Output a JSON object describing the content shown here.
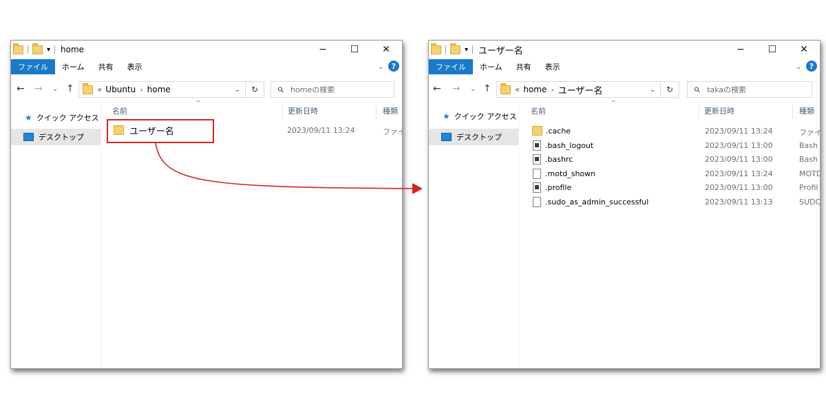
{
  "left": {
    "title": "home",
    "ribbon": {
      "file": "ファイル",
      "home": "ホーム",
      "share": "共有",
      "view": "表示"
    },
    "caption": {
      "minimize": "−",
      "maximize": "☐",
      "close": "✕"
    },
    "crumbs": {
      "more": "«",
      "c1": "Ubuntu",
      "sep": "›",
      "c2": "home"
    },
    "search_placeholder": "homeの検索",
    "sidebar": {
      "quick_access": "クイック アクセス",
      "desktop": "デスクトップ"
    },
    "columns": {
      "name": "名前",
      "date": "更新日時",
      "type": "種類"
    },
    "files": [
      {
        "name": "ユーザー名",
        "date": "2023/09/11 13:24",
        "type": "ファイル"
      }
    ]
  },
  "right": {
    "title": "ユーザー名",
    "ribbon": {
      "file": "ファイル",
      "home": "ホーム",
      "share": "共有",
      "view": "表示"
    },
    "caption": {
      "minimize": "−",
      "maximize": "☐",
      "close": "✕"
    },
    "crumbs": {
      "more": "«",
      "c1": "home",
      "sep": "›",
      "c2": "ユーザー名"
    },
    "search_placeholder": "takaの検索",
    "sidebar": {
      "quick_access": "クイック アクセス",
      "desktop": "デスクトップ"
    },
    "columns": {
      "name": "名前",
      "date": "更新日時",
      "type": "種類"
    },
    "files": [
      {
        "name": ".cache",
        "date": "2023/09/11 13:24",
        "type": "ファイル",
        "icon": "folder-icon"
      },
      {
        "name": ".bash_logout",
        "date": "2023/09/11 13:00",
        "type": "Bash",
        "icon": "script-file-icon"
      },
      {
        "name": ".bashrc",
        "date": "2023/09/11 13:00",
        "type": "Bash",
        "icon": "script-file-icon"
      },
      {
        "name": ".motd_shown",
        "date": "2023/09/11 13:24",
        "type": "MOTD",
        "icon": "file-icon"
      },
      {
        "name": ".profile",
        "date": "2023/09/11 13:00",
        "type": "Profil",
        "icon": "script-file-icon"
      },
      {
        "name": ".sudo_as_admin_successful",
        "date": "2023/09/11 13:13",
        "type": "SUDO",
        "icon": "file-icon"
      }
    ]
  },
  "colors": {
    "accent": "#1979ca",
    "annotation": "#d9221c",
    "folder": "#f5d26e"
  }
}
